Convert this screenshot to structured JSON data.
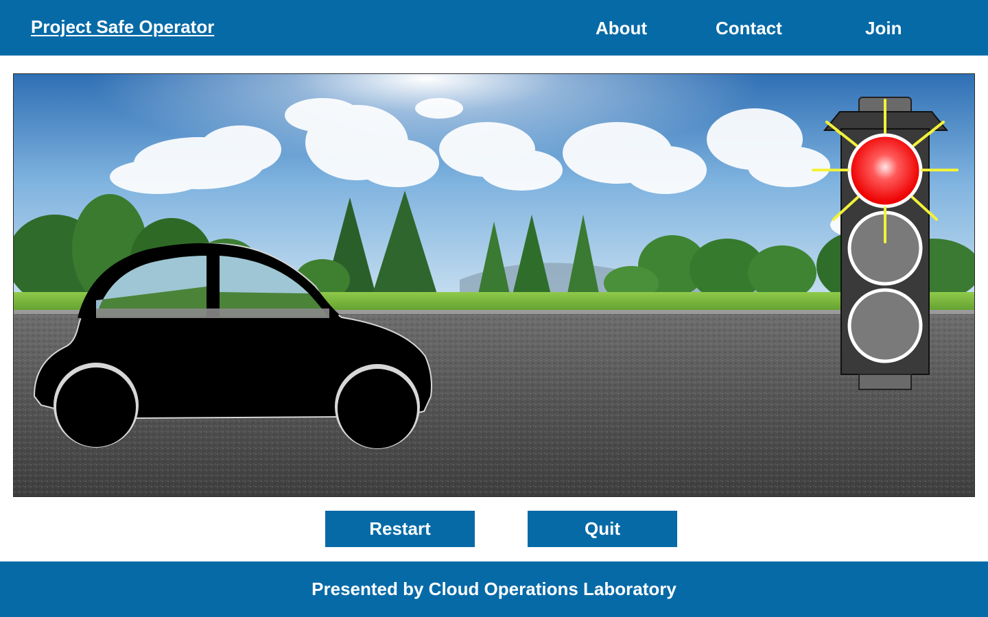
{
  "header": {
    "brand": "Project Safe Operator",
    "nav": {
      "about": "About",
      "contact": "Contact",
      "join": "Join"
    }
  },
  "scene": {
    "background": "roadside-park-photo",
    "vehicle": "car-silhouette-icon",
    "traffic_light": {
      "active_signal": "red",
      "colors": {
        "red": "#ff1010",
        "inactive": "#7a7a7a",
        "housing": "#3a3a3a",
        "glow": "#f2f23a"
      }
    }
  },
  "controls": {
    "restart_label": "Restart",
    "quit_label": "Quit"
  },
  "footer": {
    "text": "Presented by Cloud Operations Laboratory"
  },
  "theme": {
    "primary": "#066aa7"
  }
}
